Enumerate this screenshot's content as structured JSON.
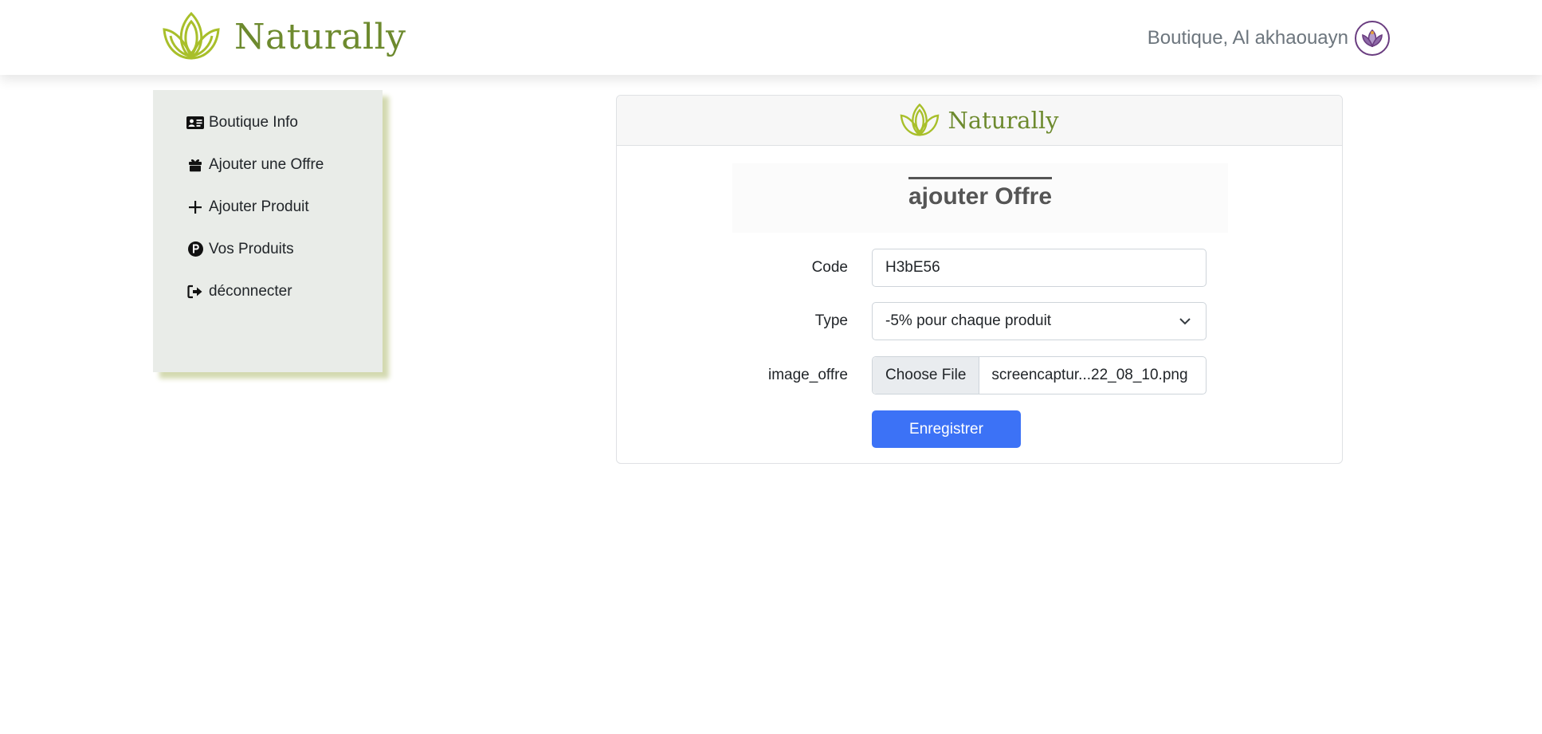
{
  "header": {
    "brand_name": "Naturally",
    "user_name": "Boutique, Al akhaouayn"
  },
  "sidebar": {
    "items": [
      {
        "label": "Boutique Info",
        "icon": "id-card-icon"
      },
      {
        "label": "Ajouter une Offre",
        "icon": "gift-icon"
      },
      {
        "label": "Ajouter Produit",
        "icon": "plus-icon"
      },
      {
        "label": "Vos Produits",
        "icon": "product-circle-icon"
      },
      {
        "label": "déconnecter",
        "icon": "sign-out-icon"
      }
    ]
  },
  "card": {
    "brand_name": "Naturally",
    "title": "ajouter Offre",
    "form": {
      "code_label": "Code",
      "code_value": "H3bE56",
      "type_label": "Type",
      "type_value": "-5% pour chaque produit",
      "image_label": "image_offre",
      "file_button": "Choose File",
      "file_name": "screencaptur...22_08_10.png",
      "submit_label": "Enregistrer"
    }
  },
  "colors": {
    "brand_green": "#6d8a2e",
    "logo_lime": "#a8bf2a",
    "sidebar_bg": "#e9ece8",
    "sidebar_shadow": "#d3d9b0",
    "primary_button": "#3c72f6",
    "avatar_purple": "#6a3d80"
  }
}
